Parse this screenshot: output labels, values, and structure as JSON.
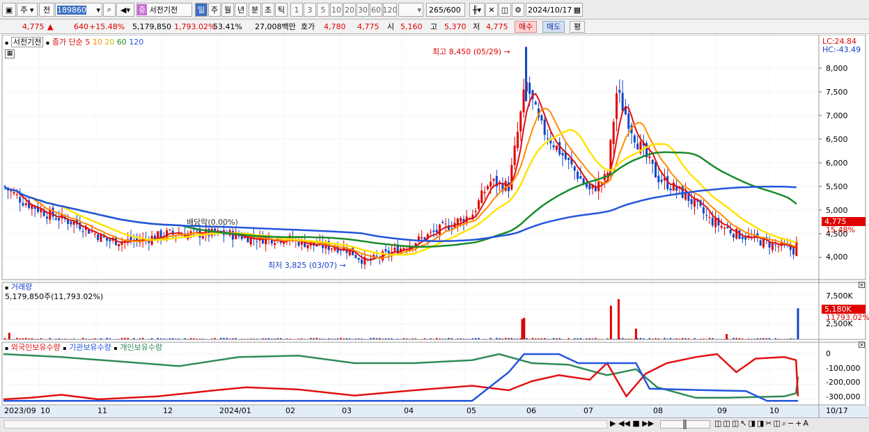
{
  "toolbar": {
    "market_tab": "주",
    "type_tab": "전",
    "code": "189860",
    "sector_tag": "중",
    "stock_name": "서전기전",
    "periods": [
      "일",
      "주",
      "월",
      "년",
      "분",
      "초",
      "틱"
    ],
    "minute_options": [
      "1",
      "3",
      "5",
      "10",
      "20",
      "30",
      "60",
      "120"
    ],
    "count": "265",
    "count_total": "/600",
    "date": "2024/10/17"
  },
  "quote": {
    "price": "4,775",
    "change_arrow": "▲",
    "change": "640",
    "change_pct": "+15.48%",
    "volume": "5,179,850",
    "volume_ratio": "1,793.02%",
    "turnover": "53.41%",
    "amount": "27,008백만",
    "ask_label": "호가",
    "ask": "4,780",
    "bid": "4,775",
    "open_label": "시",
    "open": "5,160",
    "high_label": "고",
    "high": "5,370",
    "low_label": "저",
    "low": "4,775",
    "buy_button": "매수",
    "sell_button": "매도",
    "avg_button": "평"
  },
  "price_panel": {
    "name": "서전기전",
    "ma_label": "종가 단순",
    "ma_periods": [
      "5",
      "10",
      "20",
      "60",
      "120"
    ],
    "lc": "LC:24.84",
    "hc": "HC:-43.49",
    "high_note": "최고 8,450 (05/29)",
    "low_note": "최저 3,825 (03/07)",
    "dividend_note": "배당락(0.00%)",
    "current_price_tag": "4,775",
    "current_pct_tag": "15.48%",
    "y_ticks": [
      "8,000",
      "7,500",
      "7,000",
      "6,500",
      "6,000",
      "5,500",
      "5,000",
      "4,500",
      "4,000"
    ]
  },
  "volume_panel": {
    "title": "거래량",
    "info": "5,179,850주(11,793.02%)",
    "y_ticks": [
      "7,500K",
      "5,000K",
      "2,500K"
    ],
    "current_tag": "5,180K",
    "current_pct": "11793.02%"
  },
  "holding_panel": {
    "series_labels": [
      "외국인보유수량",
      "기관보유수량",
      "개인보유수량"
    ],
    "y_ticks": [
      "0",
      "-100,000",
      "-200,000",
      "-300,000"
    ]
  },
  "x_axis": {
    "labels": [
      "2023/09",
      "10",
      "11",
      "12",
      "2024/01",
      "02",
      "03",
      "04",
      "05",
      "06",
      "07",
      "08",
      "09",
      "10"
    ],
    "end_label": "10/17"
  },
  "colors": {
    "up": "#e00000",
    "down": "#1046c8",
    "ma5": "#e01010",
    "ma10": "#ff8c00",
    "ma20": "#ffe400",
    "ma60": "#1a8a2a",
    "ma120": "#2255dd",
    "foreign": "#e01010",
    "institution": "#2255dd",
    "individual": "#2e8b57"
  },
  "chart_data": {
    "type": "candlestick",
    "x_range": [
      "2023/09",
      "2024/10/17"
    ],
    "price_ylim": [
      3825,
      8450
    ],
    "summary": {
      "high": 8450,
      "high_date": "05/29",
      "low": 3825,
      "low_date": "03/07",
      "last": 4775
    },
    "price_path": [
      [
        "2023/09/01",
        5500
      ],
      [
        "2023/09/11",
        5200
      ],
      [
        "2023/09/25",
        4900
      ],
      [
        "2023/10/10",
        4700
      ],
      [
        "2023/10/25",
        4350
      ],
      [
        "2023/11/10",
        4350
      ],
      [
        "2023/11/25",
        4500
      ],
      [
        "2023/12/10",
        4500
      ],
      [
        "2023/12/25",
        4500
      ],
      [
        "2024/01/10",
        4400
      ],
      [
        "2024/01/25",
        4400
      ],
      [
        "2024/02/10",
        4250
      ],
      [
        "2024/02/25",
        4200
      ],
      [
        "2024/03/07",
        3900
      ],
      [
        "2024/03/20",
        4100
      ],
      [
        "2024/04/05",
        4400
      ],
      [
        "2024/04/20",
        4700
      ],
      [
        "2024/05/01",
        4900
      ],
      [
        "2024/05/10",
        5600
      ],
      [
        "2024/05/20",
        5500
      ],
      [
        "2024/05/29",
        7700
      ],
      [
        "2024/06/05",
        6800
      ],
      [
        "2024/06/20",
        6000
      ],
      [
        "2024/07/01",
        5400
      ],
      [
        "2024/07/10",
        5700
      ],
      [
        "2024/07/15",
        7500
      ],
      [
        "2024/07/25",
        6500
      ],
      [
        "2024/08/05",
        5700
      ],
      [
        "2024/08/20",
        5300
      ],
      [
        "2024/09/01",
        4800
      ],
      [
        "2024/09/15",
        4500
      ],
      [
        "2024/10/01",
        4300
      ],
      [
        "2024/10/16",
        4135
      ],
      [
        "2024/10/17",
        4775
      ]
    ],
    "volume_ylim": [
      0,
      9000000
    ],
    "volume_spikes": [
      [
        "2023/09/04",
        1100000
      ],
      [
        "2024/05/27",
        3400000
      ],
      [
        "2024/05/28",
        3600000
      ],
      [
        "2024/07/12",
        5600000
      ],
      [
        "2024/07/16",
        6700000
      ],
      [
        "2024/07/25",
        1800000
      ],
      [
        "2024/09/10",
        900000
      ],
      [
        "2024/10/17",
        5179850
      ]
    ]
  }
}
